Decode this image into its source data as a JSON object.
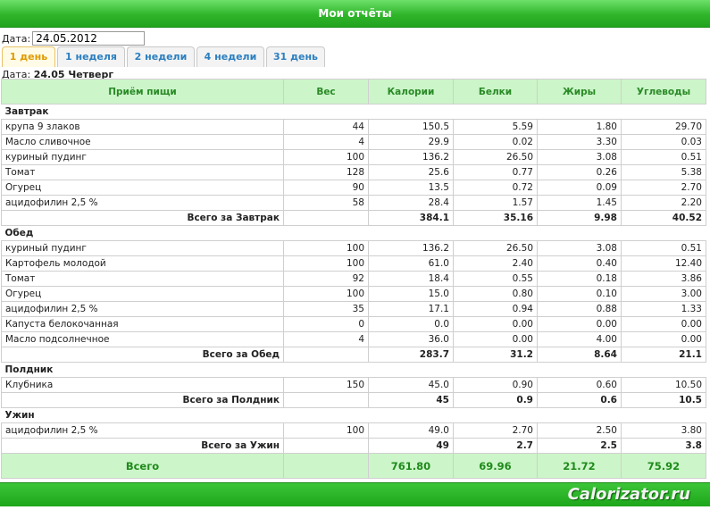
{
  "title": "Мои отчёты",
  "date_label": "Дата:",
  "date_value": "24.05.2012",
  "tabs": [
    "1 день",
    "1 неделя",
    "2 недели",
    "4 недели",
    "31 день"
  ],
  "subdate": {
    "label": "Дата:",
    "value": "24.05 Четверг"
  },
  "columns": [
    "Приём пищи",
    "Вес",
    "Калории",
    "Белки",
    "Жиры",
    "Углеводы"
  ],
  "sections": [
    {
      "name": "Завтрак",
      "rows": [
        [
          "крупа 9 злаков",
          "44",
          "150.5",
          "5.59",
          "1.80",
          "29.70"
        ],
        [
          "Масло сливочное",
          "4",
          "29.9",
          "0.02",
          "3.30",
          "0.03"
        ],
        [
          "куриный пудинг",
          "100",
          "136.2",
          "26.50",
          "3.08",
          "0.51"
        ],
        [
          "Томат",
          "128",
          "25.6",
          "0.77",
          "0.26",
          "5.38"
        ],
        [
          "Огурец",
          "90",
          "13.5",
          "0.72",
          "0.09",
          "2.70"
        ],
        [
          "ацидофилин 2,5 %",
          "58",
          "28.4",
          "1.57",
          "1.45",
          "2.20"
        ]
      ],
      "total": [
        "Всего за Завтрак",
        "",
        "384.1",
        "35.16",
        "9.98",
        "40.52"
      ]
    },
    {
      "name": "Обед",
      "rows": [
        [
          "куриный пудинг",
          "100",
          "136.2",
          "26.50",
          "3.08",
          "0.51"
        ],
        [
          "Картофель молодой",
          "100",
          "61.0",
          "2.40",
          "0.40",
          "12.40"
        ],
        [
          "Томат",
          "92",
          "18.4",
          "0.55",
          "0.18",
          "3.86"
        ],
        [
          "Огурец",
          "100",
          "15.0",
          "0.80",
          "0.10",
          "3.00"
        ],
        [
          "ацидофилин 2,5 %",
          "35",
          "17.1",
          "0.94",
          "0.88",
          "1.33"
        ],
        [
          "Капуста белокочанная",
          "0",
          "0.0",
          "0.00",
          "0.00",
          "0.00"
        ],
        [
          "Масло подсолнечное",
          "4",
          "36.0",
          "0.00",
          "4.00",
          "0.00"
        ]
      ],
      "total": [
        "Всего за Обед",
        "",
        "283.7",
        "31.2",
        "8.64",
        "21.1"
      ]
    },
    {
      "name": "Полдник",
      "rows": [
        [
          "Клубника",
          "150",
          "45.0",
          "0.90",
          "0.60",
          "10.50"
        ]
      ],
      "total": [
        "Всего за Полдник",
        "",
        "45",
        "0.9",
        "0.6",
        "10.5"
      ]
    },
    {
      "name": "Ужин",
      "rows": [
        [
          "ацидофилин 2,5 %",
          "100",
          "49.0",
          "2.70",
          "2.50",
          "3.80"
        ]
      ],
      "total": [
        "Всего за Ужин",
        "",
        "49",
        "2.7",
        "2.5",
        "3.8"
      ]
    }
  ],
  "grand_total": [
    "Всего",
    "",
    "761.80",
    "69.96",
    "21.72",
    "75.92"
  ],
  "watermark": "Calorizator.ru"
}
